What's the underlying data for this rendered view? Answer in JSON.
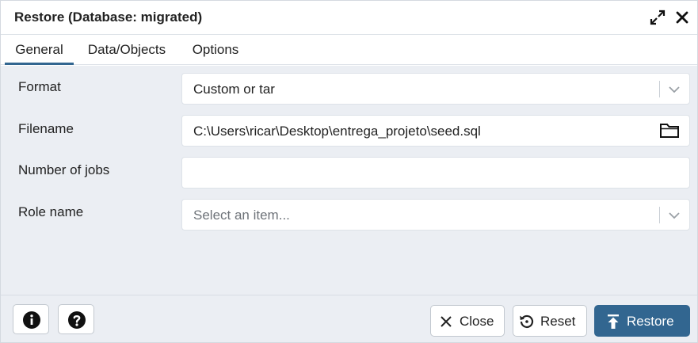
{
  "dialog": {
    "title": "Restore (Database: migrated)"
  },
  "tabs": [
    {
      "label": "General",
      "active": true
    },
    {
      "label": "Data/Objects",
      "active": false
    },
    {
      "label": "Options",
      "active": false
    }
  ],
  "form": {
    "format": {
      "label": "Format",
      "value": "Custom or tar"
    },
    "filename": {
      "label": "Filename",
      "value": "C:\\Users\\ricar\\Desktop\\entrega_projeto\\seed.sql"
    },
    "jobs": {
      "label": "Number of jobs",
      "value": ""
    },
    "role": {
      "label": "Role name",
      "placeholder": "Select an item..."
    }
  },
  "footer": {
    "close_label": "Close",
    "reset_label": "Reset",
    "restore_label": "Restore"
  },
  "icons": {
    "maximize": "maximize-icon",
    "close": "close-icon",
    "info": "info-icon",
    "help": "help-icon",
    "folder": "folder-icon",
    "chevron": "chevron-down-icon",
    "reset": "reset-icon",
    "restore": "upload-icon"
  },
  "colors": {
    "accent": "#326690",
    "body_bg": "#ebeef3"
  }
}
